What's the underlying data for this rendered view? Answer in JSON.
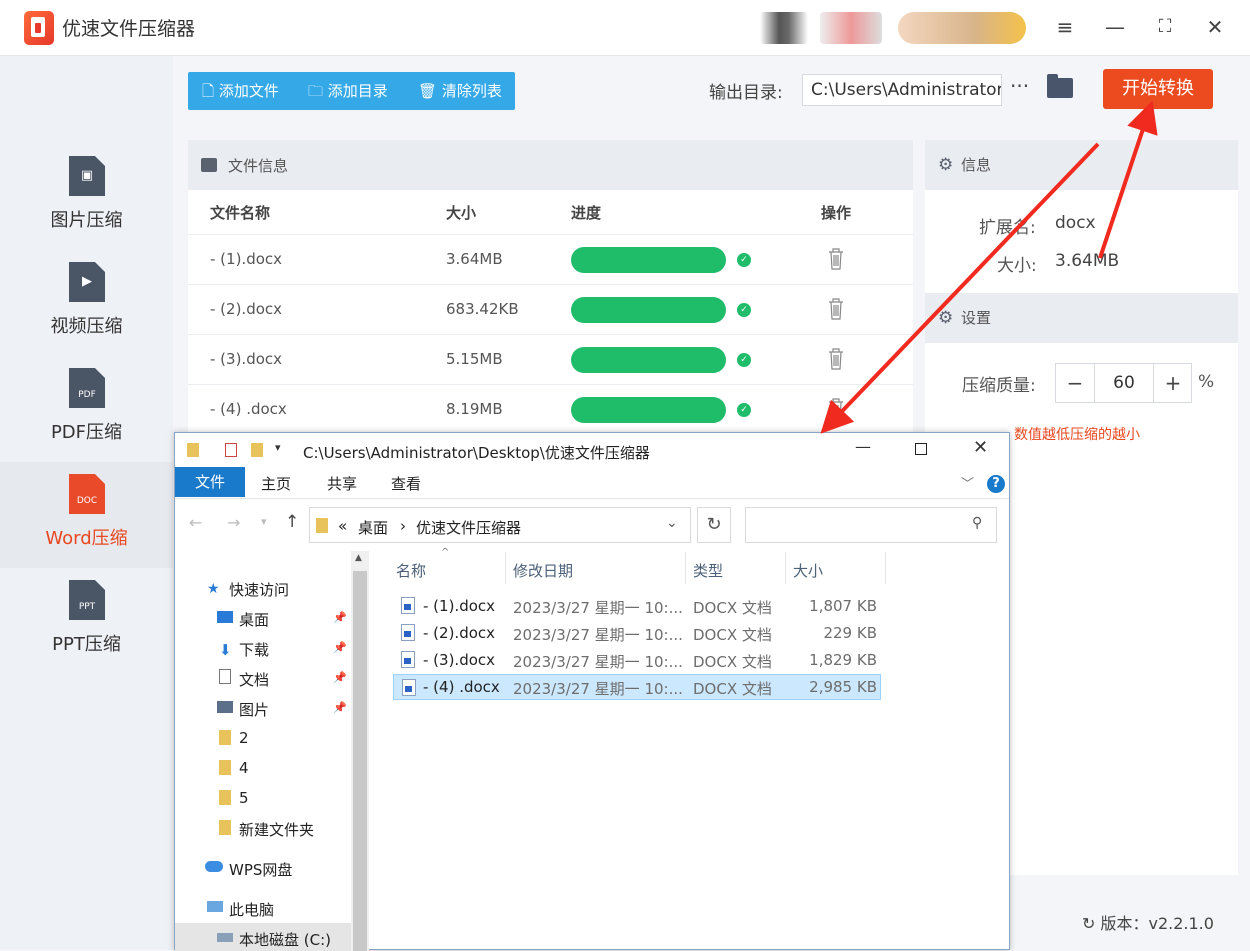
{
  "app": {
    "title": "优速文件压缩器",
    "version_label": "版本：v2.2.1.0"
  },
  "window_controls": {
    "menu": "≡",
    "maximize": "⛶",
    "close": "✕"
  },
  "sidebar": {
    "items": [
      {
        "label": "图片压缩",
        "icon": "image-file-icon"
      },
      {
        "label": "视频压缩",
        "icon": "video-file-icon"
      },
      {
        "label": "PDF压缩",
        "icon_text": "PDF"
      },
      {
        "label": "Word压缩",
        "icon_text": "DOC",
        "active": true
      },
      {
        "label": "PPT压缩",
        "icon_text": "PPT"
      }
    ]
  },
  "toolbar": {
    "add_file": "添加文件",
    "add_dir": "添加目录",
    "clear_list": "清除列表"
  },
  "output": {
    "label": "输出目录:",
    "path": "C:\\Users\\Administrator\\",
    "more": "···"
  },
  "start_button": "开始转换",
  "file_panel": {
    "title": "文件信息",
    "columns": [
      "文件名称",
      "大小",
      "进度",
      "操作"
    ],
    "rows": [
      {
        "name": "- (1).docx",
        "size": "3.64MB",
        "progress": 1.0
      },
      {
        "name": "- (2).docx",
        "size": "683.42KB",
        "progress": 1.0
      },
      {
        "name": "- (3).docx",
        "size": "5.15MB",
        "progress": 1.0
      },
      {
        "name": "- (4) .docx",
        "size": "8.19MB",
        "progress": 1.0
      }
    ]
  },
  "info_panel": {
    "title": "信息",
    "ext_label": "扩展名:",
    "ext_value": "docx",
    "size_label": "大小:",
    "size_value": "3.64MB"
  },
  "settings_panel": {
    "title": "设置",
    "quality_label": "压缩质量:",
    "quality_value": "60",
    "unit": "%",
    "hint": "数值越低压缩的越小"
  },
  "explorer": {
    "title_path": "C:\\Users\\Administrator\\Desktop\\优速文件压缩器",
    "ribbon_tabs": [
      "文件",
      "主页",
      "共享",
      "查看"
    ],
    "breadcrumb": [
      "«",
      "桌面",
      "›",
      "优速文件压缩器"
    ],
    "nav_tree": [
      {
        "label": "快速访问",
        "pinned": false
      },
      {
        "label": "桌面",
        "pinned": true
      },
      {
        "label": "下载",
        "pinned": true
      },
      {
        "label": "文档",
        "pinned": true
      },
      {
        "label": "图片",
        "pinned": true
      },
      {
        "label": "2",
        "pinned": false
      },
      {
        "label": "4",
        "pinned": false
      },
      {
        "label": "5",
        "pinned": false
      },
      {
        "label": "新建文件夹",
        "pinned": false
      },
      {
        "label": "WPS网盘",
        "pinned": false
      },
      {
        "label": "此电脑",
        "pinned": false
      },
      {
        "label": "本地磁盘 (C:)",
        "pinned": false
      }
    ],
    "columns": [
      "名称",
      "修改日期",
      "类型",
      "大小"
    ],
    "files": [
      {
        "name": "- (1).docx",
        "date": "2023/3/27 星期一 10:...",
        "type": "DOCX 文档",
        "size": "1,807 KB"
      },
      {
        "name": "- (2).docx",
        "date": "2023/3/27 星期一 10:...",
        "type": "DOCX 文档",
        "size": "229 KB"
      },
      {
        "name": "- (3).docx",
        "date": "2023/3/27 星期一 10:...",
        "type": "DOCX 文档",
        "size": "1,829 KB"
      },
      {
        "name": "- (4) .docx",
        "date": "2023/3/27 星期一 10:...",
        "type": "DOCX 文档",
        "size": "2,985 KB",
        "selected": true
      }
    ]
  },
  "colors": {
    "accent": "#ec4a1f",
    "toolbar": "#35a8e8",
    "progress": "#1fbd6a",
    "explorer_blue": "#1979ca"
  }
}
